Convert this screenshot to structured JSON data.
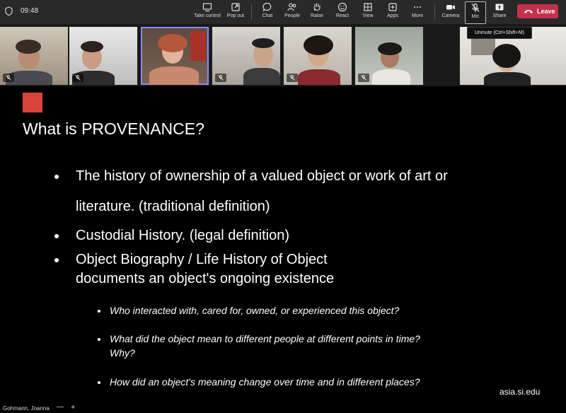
{
  "app": {
    "time": "09:48",
    "toolbar": {
      "take_control": "Take control",
      "pop_out": "Pop out",
      "chat": "Chat",
      "people": "People",
      "raise": "Raise",
      "react": "React",
      "view": "View",
      "apps": "Apps",
      "more": "More",
      "camera": "Camera",
      "mic": "Mic",
      "share": "Share",
      "leave": "Leave"
    },
    "tooltip": "Unmute (Ctrl+Shift+M)",
    "leave_color": "#c4314b",
    "speaking_outline": "#8b8cf0"
  },
  "participants": [
    {
      "id": "p1",
      "muted": true
    },
    {
      "id": "p2",
      "muted": true
    },
    {
      "id": "p3",
      "muted": false,
      "speaking": true
    },
    {
      "id": "p4",
      "muted": true
    },
    {
      "id": "p5",
      "muted": true
    },
    {
      "id": "p6",
      "muted": true
    },
    {
      "id": "p7",
      "muted": false
    }
  ],
  "slide": {
    "accent": "#d9443a",
    "title": "What is PROVENANCE?",
    "bullets": [
      {
        "line1": "The history of  ownership of a valued object or work of art or",
        "line2": "literature. (traditional definition)"
      },
      {
        "line1": "Custodial History. (legal definition)"
      },
      {
        "line1": "Object Biography / Life History of Object",
        "line2": "documents an object's ongoing existence"
      }
    ],
    "sub_bullets": [
      {
        "line1": "Who interacted with, cared for,  owned, or experienced this object?"
      },
      {
        "line1": "What did the object mean to different people at different points in time?",
        "line2": "Why?"
      },
      {
        "line1": "How did an object's meaning change over time and in different places?"
      }
    ],
    "site": "asia.si.edu"
  },
  "presenter": {
    "name": "Gohmann, Joanna",
    "zoom_out": "—",
    "zoom_in": "+"
  }
}
